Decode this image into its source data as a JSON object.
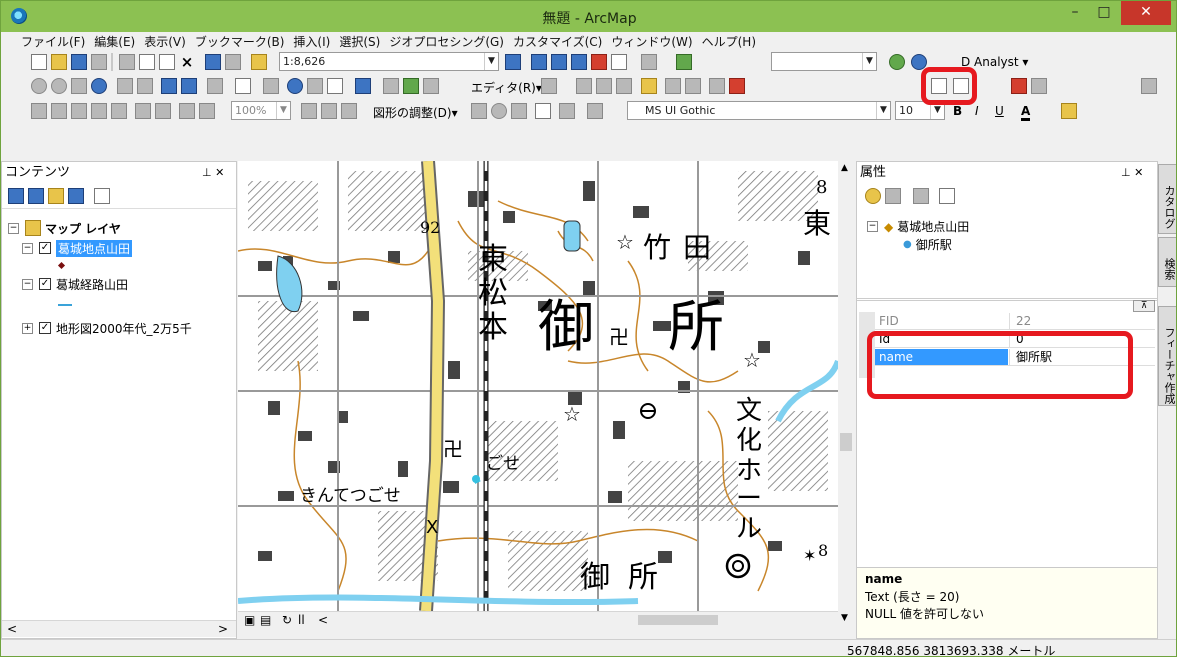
{
  "window": {
    "title": "無題 - ArcMap",
    "min_glyph": "–",
    "max_glyph": "□",
    "close_glyph": "✕"
  },
  "menu": [
    "ファイル(F)",
    "編集(E)",
    "表示(V)",
    "ブックマーク(B)",
    "挿入(I)",
    "選択(S)",
    "ジオプロセシング(G)",
    "カスタマイズ(C)",
    "ウィンドウ(W)",
    "ヘルプ(H)"
  ],
  "toolbar": {
    "scale": "1:8,626",
    "editor_label": "エディタ(R)▾",
    "analyst_label": "D Analyst ▾",
    "graphics_label": "図形の調整(D)▾",
    "font_name": "MS UI Gothic",
    "font_size": "10",
    "zoom_percent": "100%",
    "bold": "B",
    "italic": "I",
    "underline": "U",
    "font_color": "A"
  },
  "toc": {
    "title": "コンテンツ",
    "pin": "⊥ ✕",
    "root_label": "マップ レイヤ",
    "layers": [
      {
        "label": "葛城地点山田",
        "checked": "✓",
        "expand": "−"
      },
      {
        "label": "葛城経路山田",
        "checked": "✓",
        "expand": "−"
      },
      {
        "label": "地形図2000年代_2万5千",
        "checked": "✓",
        "expand": "+"
      }
    ],
    "scroll_left": "<",
    "scroll_right": ">"
  },
  "map": {
    "labels": [
      "92",
      "東",
      "松",
      "本",
      "御",
      "所",
      "竹",
      "田",
      "東",
      "8",
      "文",
      "化",
      "ホ",
      "ー",
      "ル",
      "ごせ",
      "きんてつごせ",
      "御",
      "所",
      "8"
    ],
    "nav_icons": [
      "▣",
      "▤",
      "↻",
      "ll",
      "<"
    ]
  },
  "attributes": {
    "title": "属性",
    "pin": "⊥ ✕",
    "tree_layer": "葛城地点山田",
    "tree_feature": "御所駅",
    "rows": [
      {
        "field": "FID",
        "value": "22"
      },
      {
        "field": "Id",
        "value": "0"
      },
      {
        "field": "name",
        "value": "御所駅"
      }
    ],
    "desc_title": "name",
    "desc_type": "Text (長さ = 20)",
    "desc_null": "NULL 値を許可しない"
  },
  "sidetabs": [
    "カタログ",
    "検索",
    "フィーチャ作成"
  ],
  "status": {
    "coords": "567848.856  3813693.338 メートル"
  },
  "colors": {
    "title_bar": "#8cc152",
    "highlight": "#e6191f",
    "selection": "#3399ff",
    "road_yellow": "#f3e07a",
    "river_blue": "#7fd0f0",
    "contour": "#c8862b"
  }
}
